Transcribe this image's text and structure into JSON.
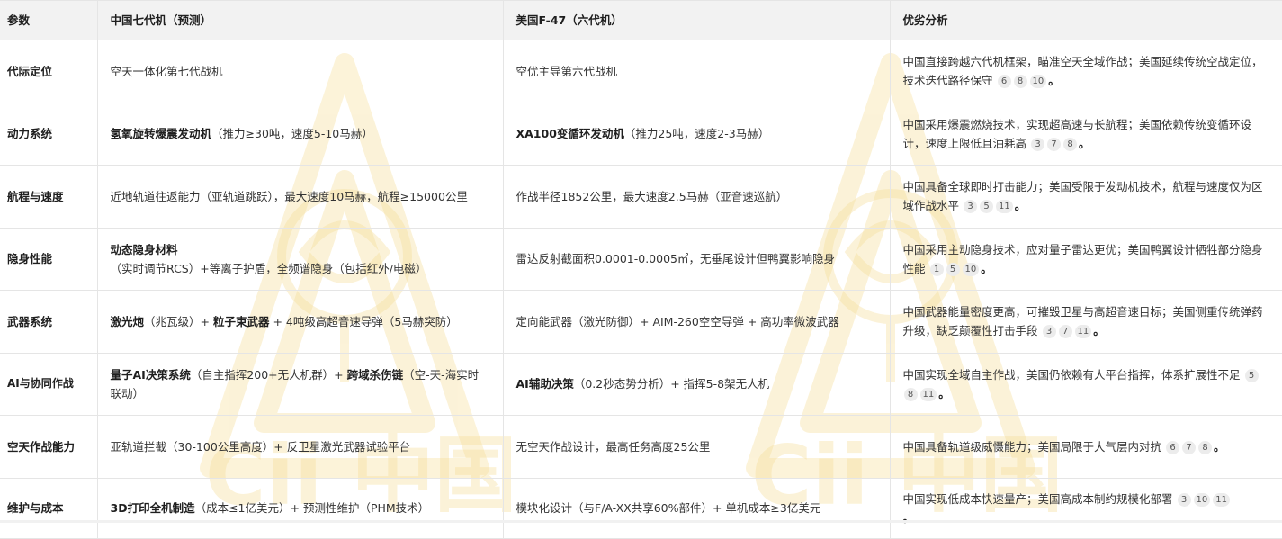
{
  "table": {
    "headers": [
      "参数",
      "中国七代机（预测）",
      "美国F-47（六代机）",
      "优劣分析"
    ],
    "rows": [
      {
        "param": "代际定位",
        "china": {
          "bold": "",
          "text": "空天一体化第七代战机"
        },
        "usa": {
          "bold": "",
          "text": "空优主导第六代战机"
        },
        "analysis": {
          "text": "中国直接跨越六代机框架，瞄准空天全域作战；美国延续传统空战定位，技术迭代路径保守",
          "cites": [
            "6",
            "8",
            "10"
          ],
          "end": "。"
        }
      },
      {
        "param": "动力系统",
        "china": {
          "bold": "氢氧旋转爆震发动机",
          "text": "（推力≥30吨，速度5-10马赫）"
        },
        "usa": {
          "bold": "XA100变循环发动机",
          "text": "（推力25吨，速度2-3马赫）"
        },
        "analysis": {
          "text": "中国采用爆震燃烧技术，实现超高速与长航程；美国依赖传统变循环设计，速度上限低且油耗高",
          "cites": [
            "3",
            "7",
            "8"
          ],
          "end": "。"
        }
      },
      {
        "param": "航程与速度",
        "china": {
          "bold": "",
          "text": "近地轨道往返能力（亚轨道跳跃），最大速度10马赫，航程≥15000公里"
        },
        "usa": {
          "bold": "",
          "text": "作战半径1852公里，最大速度2.5马赫（亚音速巡航）"
        },
        "analysis": {
          "text": "中国具备全球即时打击能力；美国受限于发动机技术，航程与速度仅为区域作战水平",
          "cites": [
            "3",
            "5",
            "11"
          ],
          "end": "。"
        }
      },
      {
        "param": "隐身性能",
        "china": {
          "bold": "动态隐身材料",
          "text": "（实时调节RCS）+等离子护盾，全频谱隐身（包括红外/电磁）"
        },
        "usa": {
          "bold": "",
          "text": "雷达反射截面积0.0001-0.0005㎡，无垂尾设计但鸭翼影响隐身"
        },
        "analysis": {
          "text": "中国采用主动隐身技术，应对量子雷达更优；美国鸭翼设计牺牲部分隐身性能",
          "cites": [
            "1",
            "5",
            "10"
          ],
          "end": "。"
        }
      },
      {
        "param": "武器系统",
        "china": {
          "b1": "激光炮",
          "t1": "（兆瓦级）+ ",
          "b2": "粒子束武器",
          "t2": " + 4吨级高超音速导弹（5马赫突防）"
        },
        "usa": {
          "bold": "",
          "text": "定向能武器（激光防御）+ AIM-260空空导弹 + 高功率微波武器"
        },
        "analysis": {
          "text": "中国武器能量密度更高，可摧毁卫星与高超音速目标；美国侧重传统弹药升级，缺乏颠覆性打击手段",
          "cites": [
            "3",
            "7",
            "11"
          ],
          "end": "。"
        }
      },
      {
        "param": "AI与协同作战",
        "china": {
          "b1": "量子AI决策系统",
          "t1": "（自主指挥200+无人机群）+ ",
          "b2": "跨域杀伤链",
          "t2": "（空-天-海实时联动）"
        },
        "usa": {
          "bold": "AI辅助决策",
          "text": "（0.2秒态势分析）+ 指挥5-8架无人机"
        },
        "analysis": {
          "text": "中国实现全域自主作战，美国仍依赖有人平台指挥，体系扩展性不足",
          "cites": [
            "5",
            "8",
            "11"
          ],
          "end": "。"
        }
      },
      {
        "param": "空天作战能力",
        "china": {
          "bold": "",
          "text": "亚轨道拦截（30-100公里高度）+ 反卫星激光武器试验平台"
        },
        "usa": {
          "bold": "",
          "text": "无空天作战设计，最高任务高度25公里"
        },
        "analysis": {
          "text": "中国具备轨道级威慑能力；美国局限于大气层内对抗",
          "cites": [
            "6",
            "7",
            "8"
          ],
          "end": "。"
        }
      },
      {
        "param": "维护与成本",
        "china": {
          "bold": "3D打印全机制造",
          "text": "（成本≤1亿美元）+ 预测性维护（PHM技术）"
        },
        "usa": {
          "bold": "",
          "text": "模块化设计（与F/A-XX共享60%部件）+ 单机成本≥3亿美元"
        },
        "analysis": {
          "text": "中国实现低成本快速量产；美国高成本制约规模化部署",
          "cites": [
            "3",
            "10",
            "11"
          ],
          "end": "。"
        }
      }
    ]
  },
  "watermark": {
    "text": "Cii 中国",
    "color": "#f3d27a"
  }
}
